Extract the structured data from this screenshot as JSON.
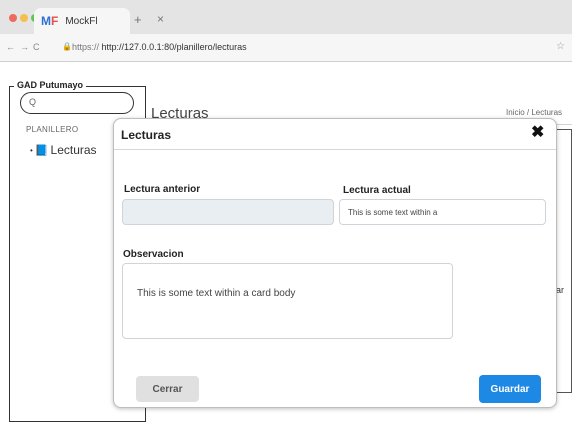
{
  "browser": {
    "tab_title": "MockFl",
    "new_tab_symbol": "+",
    "close_symbol": "×",
    "back_symbol": "←",
    "forward_symbol": "→",
    "reload_symbol": "C",
    "url_scheme": "https://",
    "url_rest": "http://127.0.0.1:80/planillero/lecturas",
    "bookmark_symbol": "☆"
  },
  "sidebar": {
    "brand": "GAD Putumayo",
    "search_icon": "Q",
    "section_label": "PLANILLERO",
    "items": [
      {
        "label": "Lecturas",
        "bullet": "•",
        "icon": "book-icon",
        "icon_glyph": "📘"
      }
    ]
  },
  "content": {
    "title": "Lecturas",
    "breadcrumb": "Inicio / Lecturas",
    "partial_text": "ar"
  },
  "modal": {
    "title": "Lecturas",
    "close_glyph": "✖",
    "fields": {
      "lectura_anterior": {
        "label": "Lectura anterior",
        "value": ""
      },
      "lectura_actual": {
        "label": "Lectura actual",
        "value": "This is some text within a"
      },
      "observacion": {
        "label": "Observacion",
        "value": "This is some text within a card body"
      }
    },
    "buttons": {
      "cerrar": "Cerrar",
      "guardar": "Guardar"
    }
  },
  "colors": {
    "primary": "#1e88e5",
    "secondary": "#e0e0e0",
    "disabled_field": "#e9eef3"
  }
}
